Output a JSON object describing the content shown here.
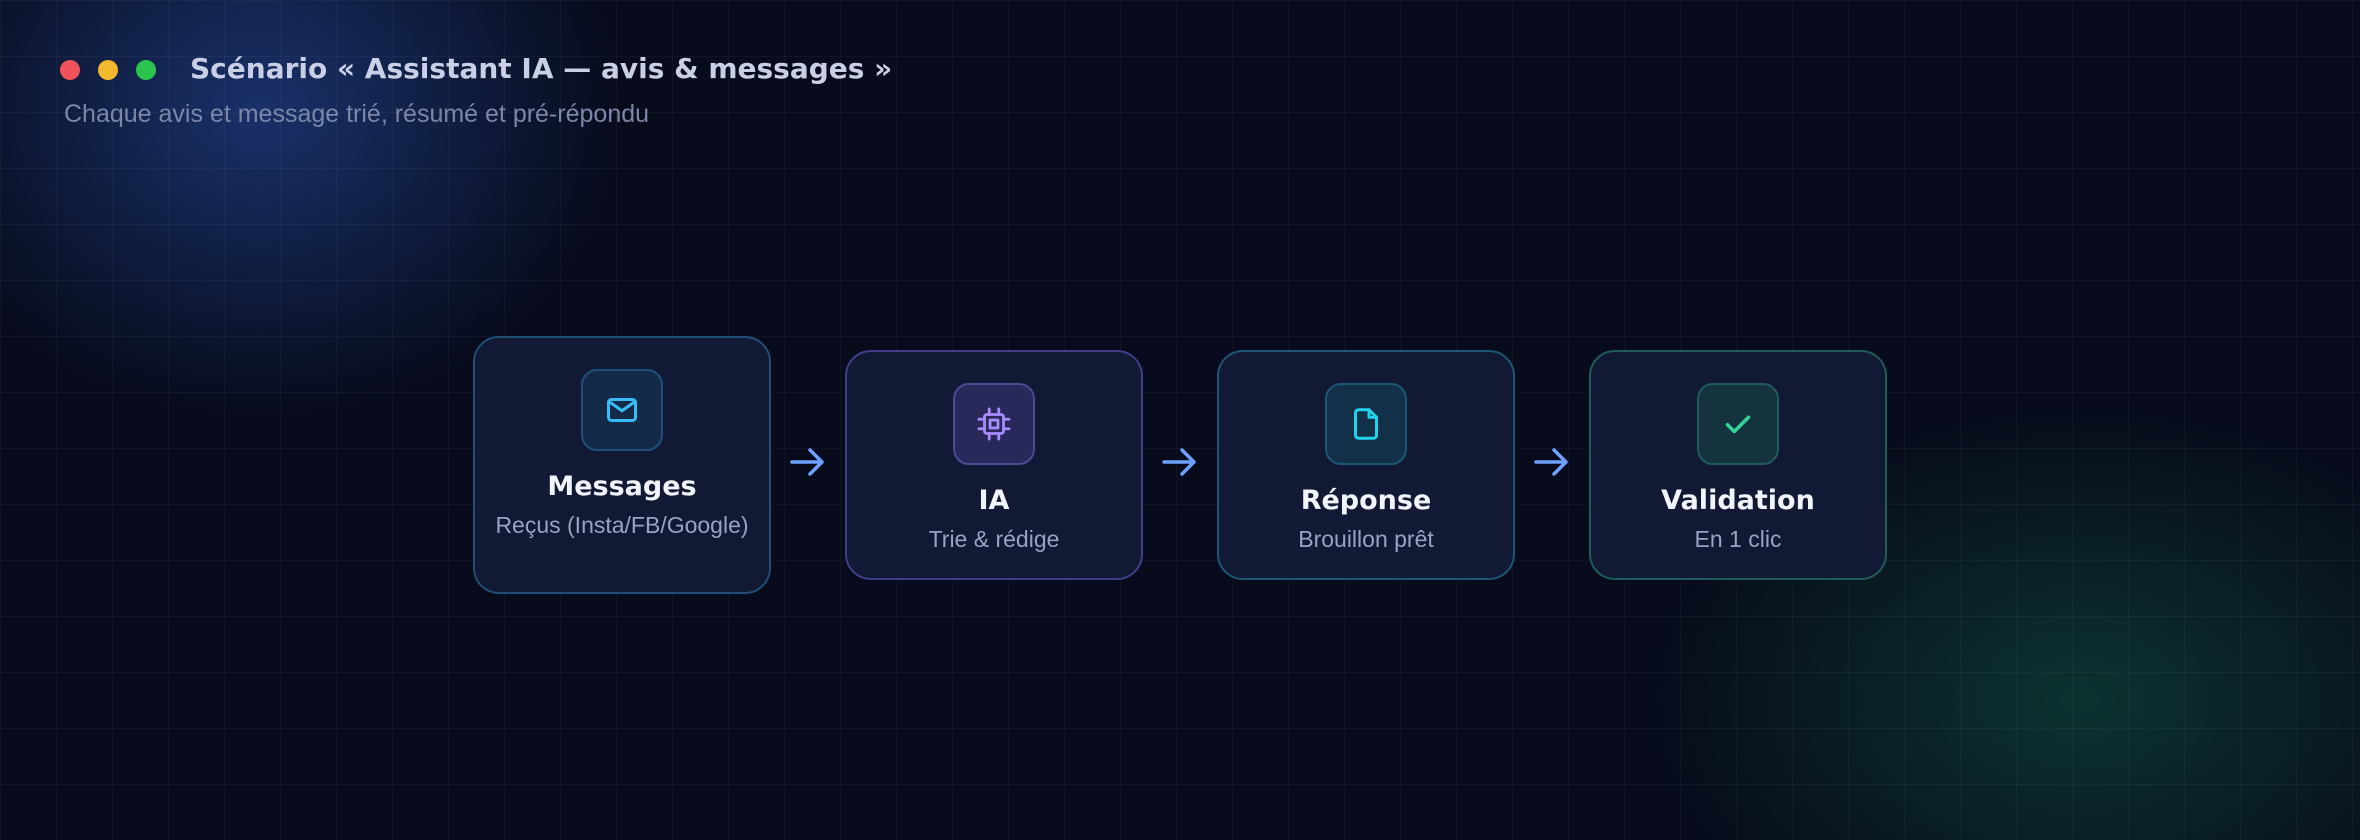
{
  "window": {
    "title": "Scénario « Assistant IA — avis & messages »",
    "subtitle": "Chaque avis et message trié, résumé et pré-répondu",
    "dots": [
      "#f0545a",
      "#f4b82e",
      "#2dc44e"
    ]
  },
  "steps": [
    {
      "title": "Messages",
      "subtitle": "Reçus (Insta/FB/Google)",
      "icon": "mail-icon",
      "accent": "#38bdf8",
      "border": "#1f4f78"
    },
    {
      "title": "IA",
      "subtitle": "Trie & rédige",
      "icon": "cpu-icon",
      "accent": "#a78bfa",
      "border": "#3d3f8a"
    },
    {
      "title": "Réponse",
      "subtitle": "Brouillon prêt",
      "icon": "document-icon",
      "accent": "#22d3ee",
      "border": "#1b5774"
    },
    {
      "title": "Validation",
      "subtitle": "En 1 clic",
      "icon": "check-icon",
      "accent": "#34d399",
      "border": "#1d5c5a"
    }
  ],
  "arrow_color": "#6ea0ff"
}
